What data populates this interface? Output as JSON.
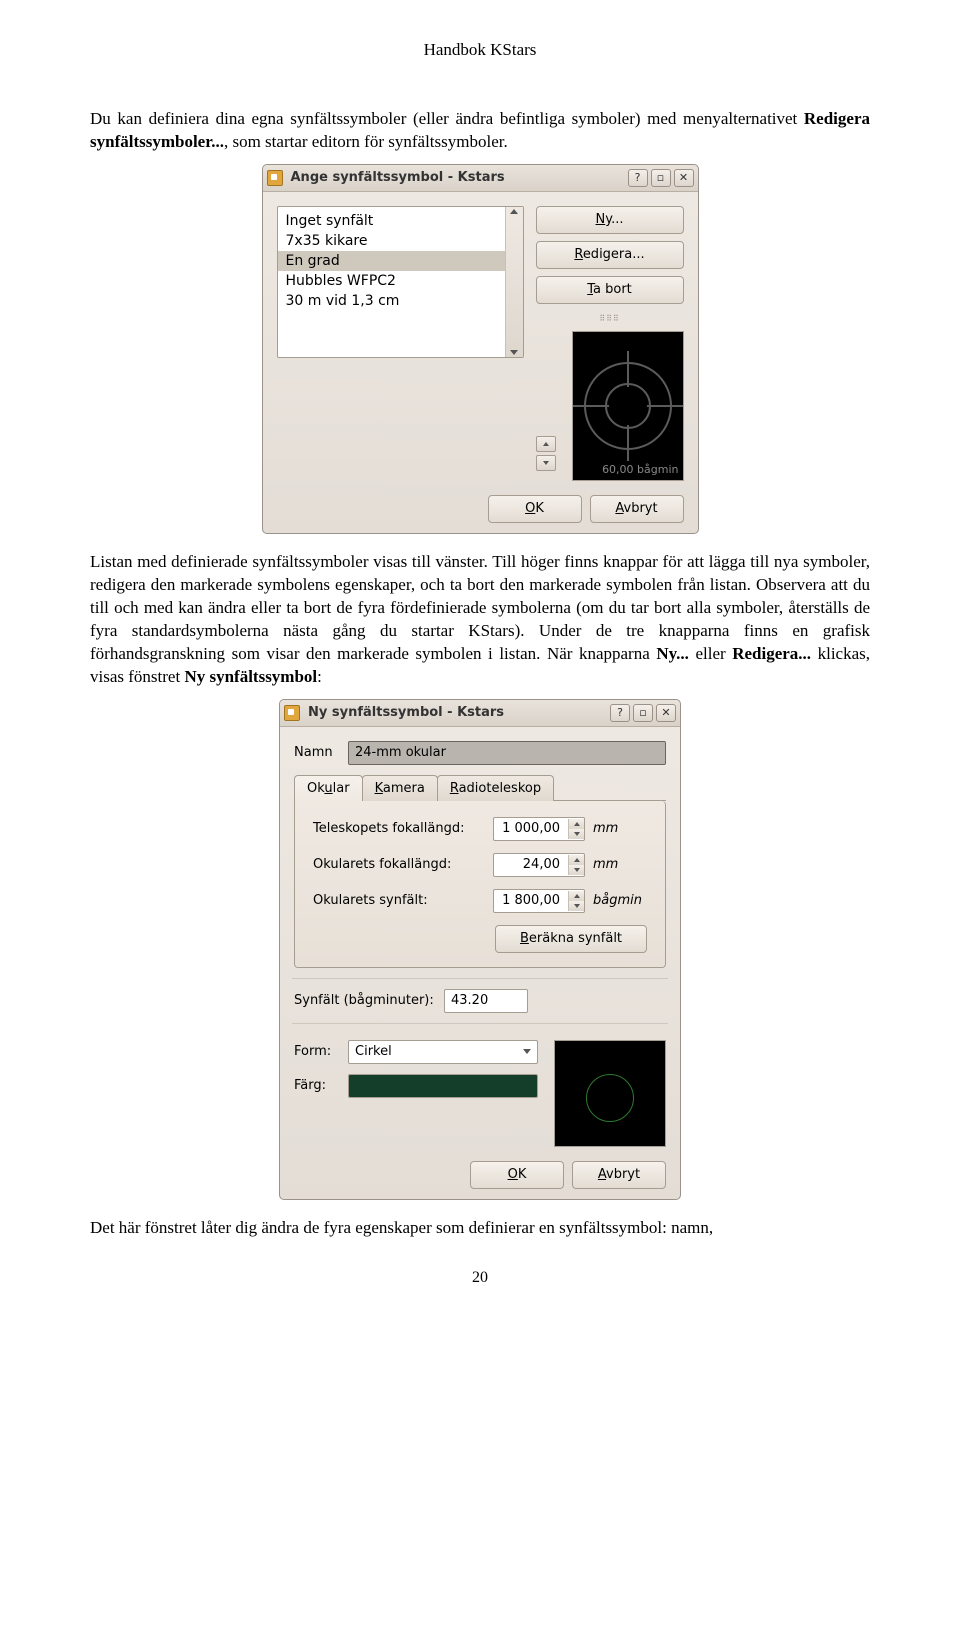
{
  "header": "Handbok KStars",
  "intro": {
    "t1": "Du kan definiera dina egna synfältssymboler (eller ändra befintliga symboler) med menyalternativet ",
    "b1": "Redigera synfältssymboler...",
    "t2": ", som startar editorn för synfältssymboler."
  },
  "dialog1": {
    "title": "Ange synfältssymbol - Kstars",
    "list": {
      "items": [
        "Inget synfält",
        "7x35 kikare",
        "En grad",
        "Hubbles WFPC2",
        "30 m vid 1,3 cm"
      ],
      "selected_index": 2
    },
    "buttons": {
      "new": "Ny...",
      "edit": "Redigera...",
      "delete": "Ta bort"
    },
    "preview_label": "60,00 bågmin",
    "ok": "OK",
    "cancel": "Avbryt"
  },
  "para2": {
    "t1": "Listan med definierade synfältssymboler visas till vänster. Till höger finns knappar för att lägga till nya symboler, redigera den markerade symbolens egenskaper, och ta bort den markerade symbolen från listan. Observera att du till och med kan ändra eller ta bort de fyra fördefinierade symbolerna (om du tar bort alla symboler, återställs de fyra standardsymbolerna nästa gång du startar KStars). Under de tre knapparna finns en grafisk förhandsgranskning som visar den markerade symbolen i listan. När knapparna ",
    "b1": "Ny...",
    "t2": " eller ",
    "b2": "Redigera...",
    "t3": " klickas, visas fönstret ",
    "b3": "Ny synfältssymbol",
    "t4": ":"
  },
  "dialog2": {
    "title": "Ny synfältssymbol - Kstars",
    "name_label": "Namn",
    "name_value": "24-mm okular",
    "tabs": {
      "okular": "Okular",
      "kamera": "Kamera",
      "radio": "Radioteleskop"
    },
    "fields": {
      "telescope_focal": {
        "label": "Teleskopets fokallängd:",
        "value": "1 000,00",
        "unit": "mm"
      },
      "ocular_focal": {
        "label": "Okularets fokallängd:",
        "value": "24,00",
        "unit": "mm"
      },
      "ocular_fov": {
        "label": "Okularets synfält:",
        "value": "1 800,00",
        "unit": "bågmin"
      }
    },
    "calc": "Beräkna synfält",
    "fov_label": "Synfält (bågminuter):",
    "fov_value": "43.20",
    "form_label": "Form:",
    "form_value": "Cirkel",
    "color_label": "Färg:",
    "ok": "OK",
    "cancel": "Avbryt"
  },
  "outro": "Det här fönstret låter dig ändra de fyra egenskaper som definierar en synfältssymbol: namn,",
  "page_number": "20"
}
